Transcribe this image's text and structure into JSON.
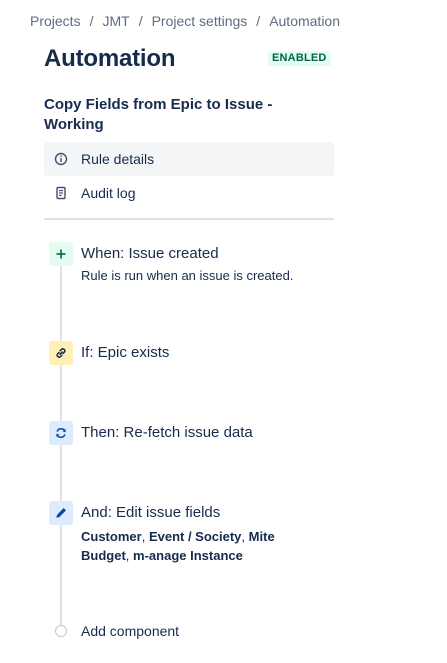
{
  "breadcrumb": {
    "items": [
      "Projects",
      "JMT",
      "Project settings",
      "Automation"
    ],
    "separator": "/"
  },
  "header": {
    "title": "Automation",
    "status": "ENABLED"
  },
  "rule": {
    "name": "Copy Fields from Epic to Issue - Working"
  },
  "nav": {
    "items": [
      {
        "label": "Rule details",
        "icon": "info-icon",
        "active": true
      },
      {
        "label": "Audit log",
        "icon": "document-icon",
        "active": false
      }
    ]
  },
  "steps": {
    "trigger": {
      "title": "When: Issue created",
      "description": "Rule is run when an issue is created.",
      "icon": "plus-icon",
      "color": "#e3fcef"
    },
    "condition": {
      "title": "If: Epic exists",
      "icon": "link-icon",
      "color": "#fff0b3"
    },
    "action1": {
      "title": "Then: Re-fetch issue data",
      "icon": "refresh-icon",
      "color": "#deebff"
    },
    "action2": {
      "title": "And: Edit issue fields",
      "icon": "pencil-icon",
      "color": "#deebff",
      "fields": [
        "Customer",
        "Event / Society",
        "Mite Budget",
        "m-anage Instance"
      ],
      "field_separator": ","
    }
  },
  "add_component": {
    "label": "Add component"
  }
}
